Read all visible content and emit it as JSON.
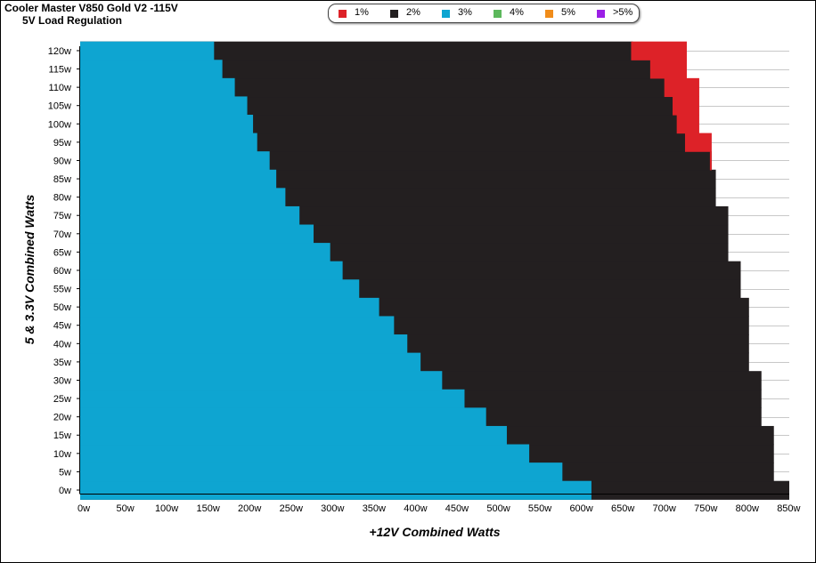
{
  "title": "Cooler Master V850 Gold V2 -115V",
  "subtitle": "5V Load Regulation",
  "chart_data": {
    "type": "heatmap",
    "xlabel": "+12V Combined Watts",
    "ylabel": "5 & 3.3V Combined Watts",
    "xlim": [
      0,
      850
    ],
    "ylim": [
      0,
      120
    ],
    "x_ticks": [
      "0w",
      "50w",
      "100w",
      "150w",
      "200w",
      "250w",
      "300w",
      "350w",
      "400w",
      "450w",
      "500w",
      "550w",
      "600w",
      "650w",
      "700w",
      "750w",
      "800w",
      "850w"
    ],
    "y_ticks": [
      "0w",
      "5w",
      "10w",
      "15w",
      "20w",
      "25w",
      "30w",
      "35w",
      "40w",
      "45w",
      "50w",
      "55w",
      "60w",
      "65w",
      "70w",
      "75w",
      "80w",
      "85w",
      "90w",
      "95w",
      "100w",
      "105w",
      "110w",
      "115w",
      "120w"
    ],
    "legend": [
      {
        "label": "1%",
        "color": "#dd2228"
      },
      {
        "label": "2%",
        "color": "#231f20"
      },
      {
        "label": "3%",
        "color": "#0ea5d1"
      },
      {
        "label": "4%",
        "color": "#5cb85c"
      },
      {
        "label": "5%",
        "color": "#f08c1a"
      },
      {
        "label": ">5%",
        "color": "#9b1fe6"
      }
    ],
    "series": [
      {
        "name": "3%",
        "color": "#0ea5d1",
        "y": [
          0,
          5,
          10,
          15,
          20,
          25,
          30,
          35,
          40,
          45,
          50,
          55,
          60,
          65,
          70,
          75,
          80,
          85,
          90,
          95,
          100,
          105,
          110,
          115,
          120
        ],
        "x_max": [
          610,
          575,
          535,
          508,
          483,
          457,
          430,
          404,
          388,
          372,
          354,
          330,
          310,
          295,
          275,
          258,
          241,
          230,
          222,
          207,
          202,
          195,
          180,
          165,
          155
        ]
      },
      {
        "name": "2%",
        "color": "#231f20",
        "y": [
          0,
          5,
          10,
          15,
          20,
          25,
          30,
          35,
          40,
          45,
          50,
          55,
          60,
          65,
          70,
          75,
          80,
          85,
          90,
          95,
          100,
          105,
          110,
          115,
          120
        ],
        "x_max": [
          850,
          830,
          830,
          830,
          815,
          815,
          815,
          800,
          800,
          800,
          800,
          790,
          790,
          775,
          775,
          775,
          760,
          760,
          755,
          725,
          715,
          710,
          700,
          683,
          660
        ]
      },
      {
        "name": "1%",
        "color": "#dd2228",
        "y": [
          90,
          95,
          100,
          105,
          110,
          115,
          120
        ],
        "x_min": [
          755,
          725,
          715,
          710,
          700,
          683,
          660
        ],
        "x_max": [
          755,
          755,
          740,
          740,
          740,
          725,
          725
        ]
      }
    ],
    "grid": "horizontal",
    "legend_position": "top"
  }
}
